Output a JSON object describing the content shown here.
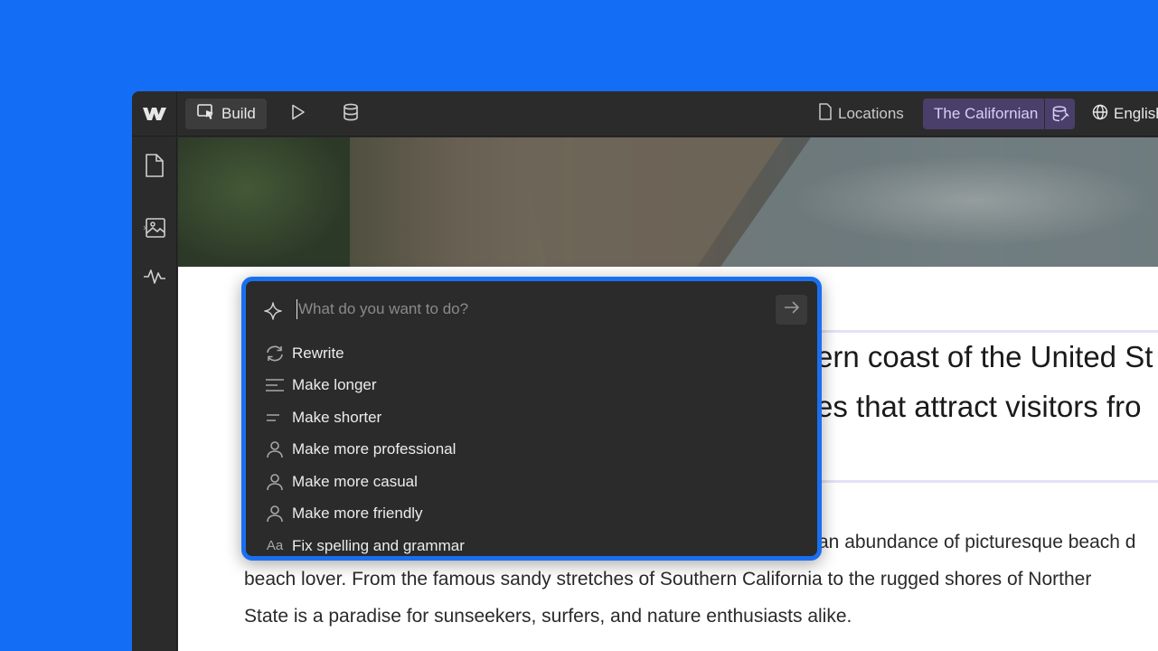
{
  "toolbar": {
    "build_label": "Build",
    "locations_label": "Locations",
    "locale_label": "The Californian",
    "language_label": "English"
  },
  "canvas": {
    "heading_line_1": "ern coast of the United St",
    "heading_line_2": "es that attract visitors fro",
    "para_line_1": "an abundance of picturesque beach d",
    "para_line_2": "beach lover. From the famous sandy stretches of Southern California to the rugged shores of Norther",
    "para_line_3": "State is a paradise for sunseekers, surfers, and nature enthusiasts alike."
  },
  "ai": {
    "placeholder": "What do you want to do?",
    "items": [
      {
        "label": "Rewrite",
        "icon": "rewrite-icon"
      },
      {
        "label": "Make longer",
        "icon": "make-longer-icon"
      },
      {
        "label": "Make shorter",
        "icon": "make-shorter-icon"
      },
      {
        "label": "Make more professional",
        "icon": "person-icon"
      },
      {
        "label": "Make more casual",
        "icon": "person-icon"
      },
      {
        "label": "Make more friendly",
        "icon": "person-icon"
      },
      {
        "label": "Fix spelling and grammar",
        "icon": "spelling-icon",
        "glyph": "Aa"
      }
    ]
  },
  "colors": {
    "background": "#146ef5",
    "panel": "#2b2b2b",
    "accent": "#1a6ff0",
    "locale": "#4a3f6b"
  }
}
